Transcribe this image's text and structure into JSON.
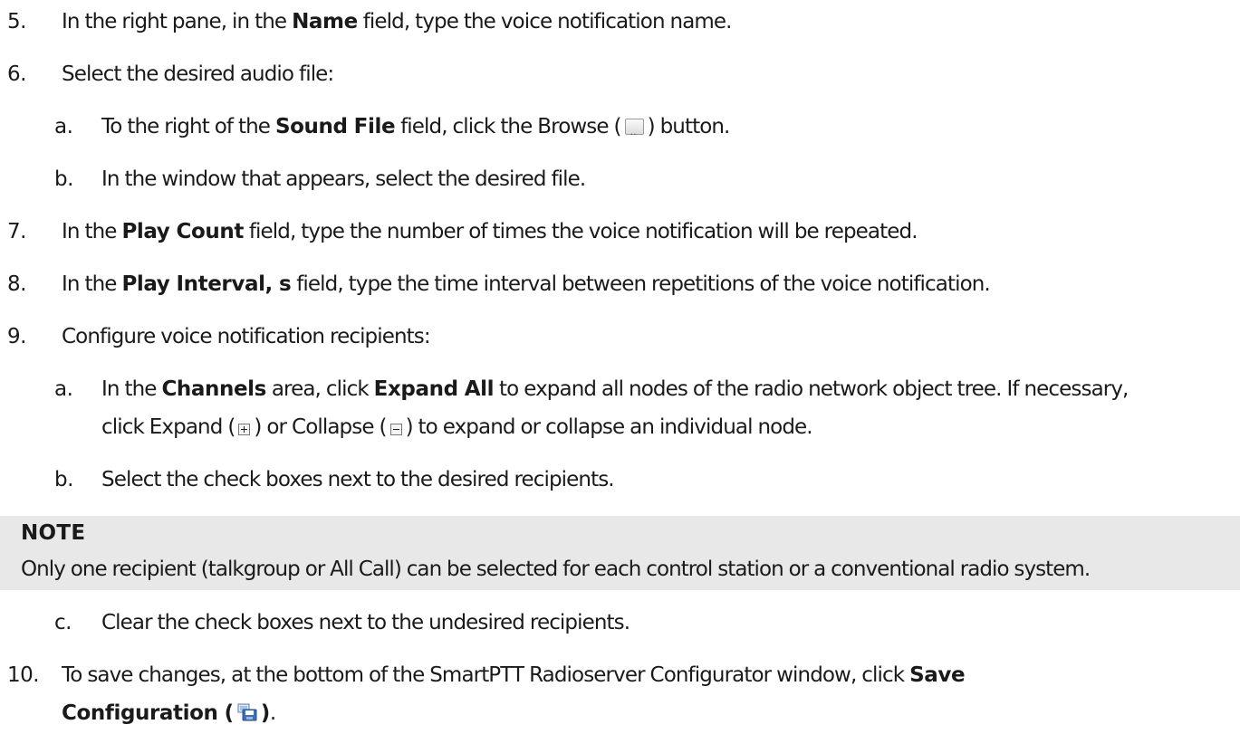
{
  "steps": {
    "s5": {
      "num": "5.",
      "pre": "In the right pane, in the ",
      "bold": "Name",
      "post": " field, type the voice notification name."
    },
    "s6": {
      "num": "6.",
      "text": "Select the desired audio file:"
    },
    "s6a": {
      "num": "a.",
      "pre": "To the right of the ",
      "bold": "Sound File",
      "mid": " field, click the Browse (",
      "post": ") button."
    },
    "s6b": {
      "num": "b.",
      "text": "In the window that appears, select the desired file."
    },
    "s7": {
      "num": "7.",
      "pre": "In the ",
      "bold": "Play Count",
      "post": " field, type the number of times the voice notification will be repeated."
    },
    "s8": {
      "num": "8.",
      "pre": "In the ",
      "bold": "Play Interval, s",
      "post": " field, type the time interval between repetitions of the voice notification."
    },
    "s9": {
      "num": "9.",
      "text": "Configure voice notification recipients:"
    },
    "s9a": {
      "num": "a.",
      "pre": "In the ",
      "bold1": "Channels",
      "mid": " area, click ",
      "bold2": "Expand All",
      "post": " to expand all nodes of the radio network object tree. If necessary,",
      "line2_pre": "click Expand (",
      "line2_mid": ") or Collapse (",
      "line2_post": ") to expand or collapse an individual node."
    },
    "s9b": {
      "num": "b.",
      "text": "Select the check boxes next to the desired recipients."
    },
    "s9c": {
      "num": "c.",
      "text": "Clear the check boxes next to the undesired recipients."
    },
    "s10": {
      "num": "10.",
      "pre": "To save changes, at the bottom of the SmartPTT Radioserver Configurator window, click ",
      "bold": "Save",
      "line2_bold_pre": "Configuration (",
      "line2_bold_post": ")",
      "line2_post": "."
    }
  },
  "note": {
    "title": "NOTE",
    "text": "Only one recipient (talkgroup or All Call) can be selected for each control station or a conventional radio system."
  },
  "icons": {
    "browse": "browse-icon",
    "expand": "expand-plus-icon",
    "collapse": "collapse-minus-icon",
    "save": "save-configuration-icon"
  }
}
